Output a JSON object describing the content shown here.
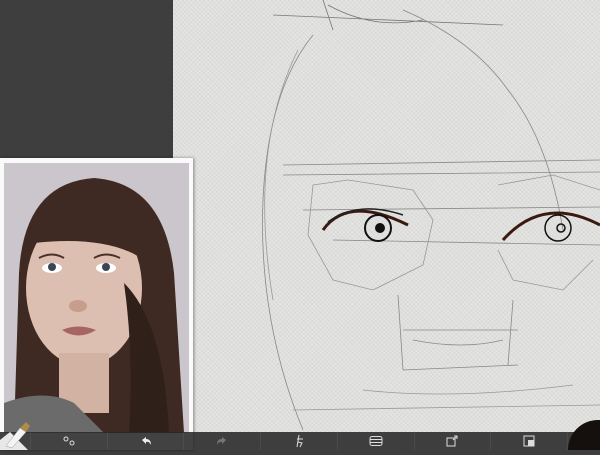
{
  "app": {
    "accent_color": "#15100d"
  },
  "toolbar": {
    "items": [
      {
        "name": "settings",
        "icon": "settings-icon"
      },
      {
        "name": "undo",
        "icon": "undo-icon"
      },
      {
        "name": "redo",
        "icon": "redo-icon",
        "disabled": true
      },
      {
        "name": "tracing",
        "icon": "tracing-figure-icon"
      },
      {
        "name": "layers",
        "icon": "layers-icon"
      },
      {
        "name": "share",
        "icon": "share-icon"
      },
      {
        "name": "gallery",
        "icon": "gallery-icon"
      }
    ]
  },
  "tool": {
    "current": "brush",
    "icon": "brush-icon"
  },
  "color_picker": {
    "current_color": "#15100d"
  },
  "reference": {
    "type": "photo-reference",
    "subject": "portrait"
  }
}
